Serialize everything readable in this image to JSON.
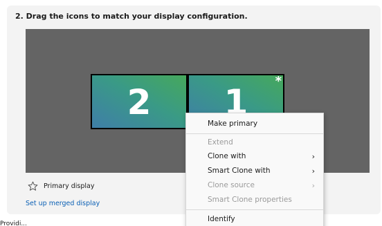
{
  "step": {
    "title": "2. Drag the icons to match your display configuration."
  },
  "displays": [
    {
      "label": "2",
      "primary": false
    },
    {
      "label": "1",
      "primary": true,
      "marker": "*"
    }
  ],
  "primary_display": {
    "icon": "star-outline-icon",
    "label": "Primary display"
  },
  "merged_display_link": "Set up merged display",
  "footer_partial_text": "Providi...",
  "context_menu": {
    "items": [
      {
        "label": "Make primary",
        "enabled": true,
        "submenu": false
      },
      {
        "label": "Extend",
        "enabled": false,
        "submenu": false
      },
      {
        "label": "Clone with",
        "enabled": true,
        "submenu": true
      },
      {
        "label": "Smart Clone with",
        "enabled": true,
        "submenu": true
      },
      {
        "label": "Clone source",
        "enabled": false,
        "submenu": true
      },
      {
        "label": "Smart Clone properties",
        "enabled": false,
        "submenu": false
      },
      {
        "label": "Identify",
        "enabled": true,
        "submenu": false
      }
    ],
    "submenu_arrow": "›"
  },
  "colors": {
    "canvas": "#646464",
    "monitor_gradient_start": "#3f7ea8",
    "monitor_gradient_end": "#46a85c",
    "link": "#0a5fb4"
  }
}
